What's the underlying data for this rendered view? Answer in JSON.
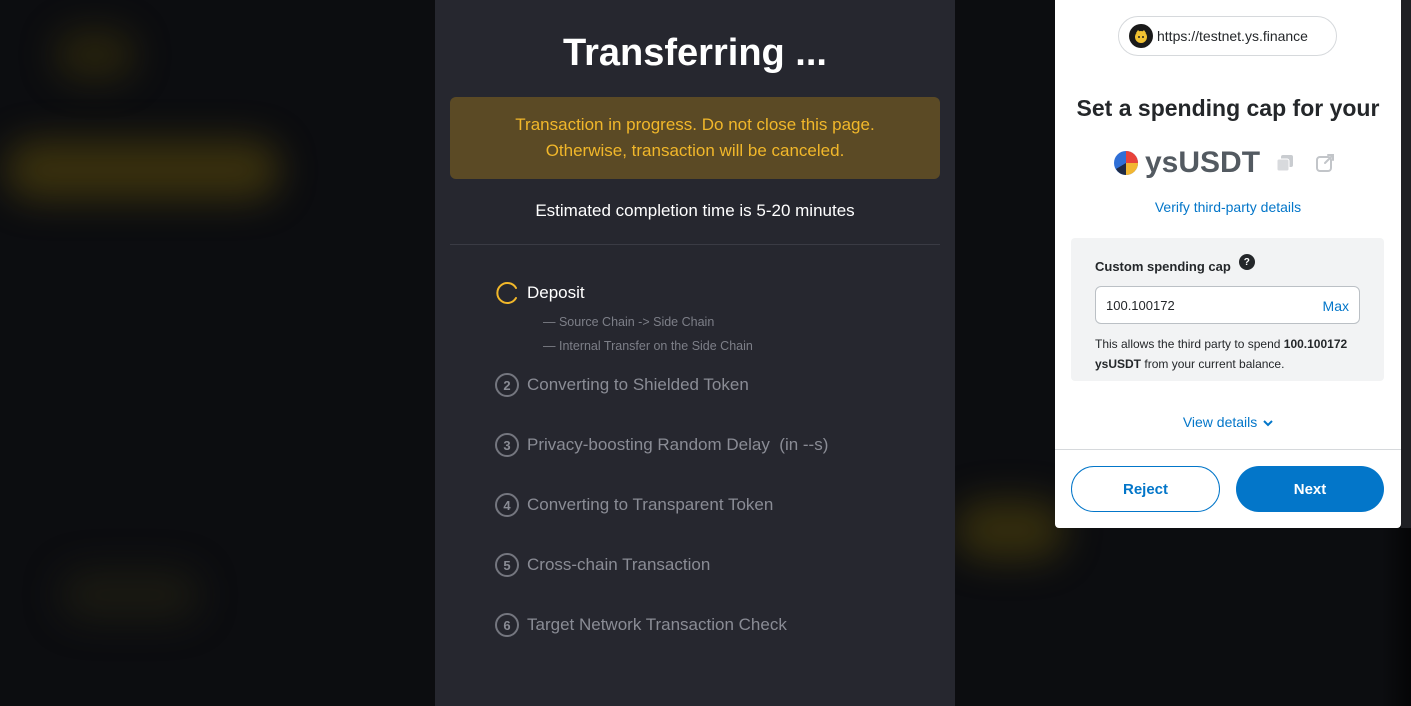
{
  "transfer": {
    "title": "Transferring ...",
    "warning_line1": "Transaction in progress. Do not close this page.",
    "warning_line2": "Otherwise, transaction will be canceled.",
    "estimate": "Estimated completion time is 5-20 minutes",
    "steps": [
      {
        "num": "",
        "label": "Deposit",
        "state": "active"
      },
      {
        "num": "2",
        "label": "Converting to Shielded Token",
        "state": "pending"
      },
      {
        "num": "3",
        "label": "Privacy-boosting Random Delay  (in --s)",
        "state": "pending"
      },
      {
        "num": "4",
        "label": "Converting to Transparent Token",
        "state": "pending"
      },
      {
        "num": "5",
        "label": "Cross-chain Transaction",
        "state": "pending"
      },
      {
        "num": "6",
        "label": "Target Network Transaction Check",
        "state": "pending"
      }
    ],
    "substeps": [
      "— Source Chain -> Side Chain",
      "— Internal Transfer on the Side Chain"
    ]
  },
  "wallet": {
    "origin": "https://testnet.ys.finance",
    "title": "Set a spending cap for your",
    "token_name": "ysUSDT",
    "verify_link": "Verify third-party details",
    "cap_label": "Custom spending cap",
    "help_glyph": "?",
    "cap_value": "100.100172",
    "max_label": "Max",
    "allow_prefix": "This allows the third party to spend",
    "allow_amount": "100.100172 ysUSDT",
    "allow_suffix": "from your current balance.",
    "view_details": "View details",
    "reject_label": "Reject",
    "next_label": "Next"
  },
  "colors": {
    "accent_yellow": "#f1b72a",
    "modal_bg": "#26272f",
    "wallet_blue": "#0376c9"
  }
}
